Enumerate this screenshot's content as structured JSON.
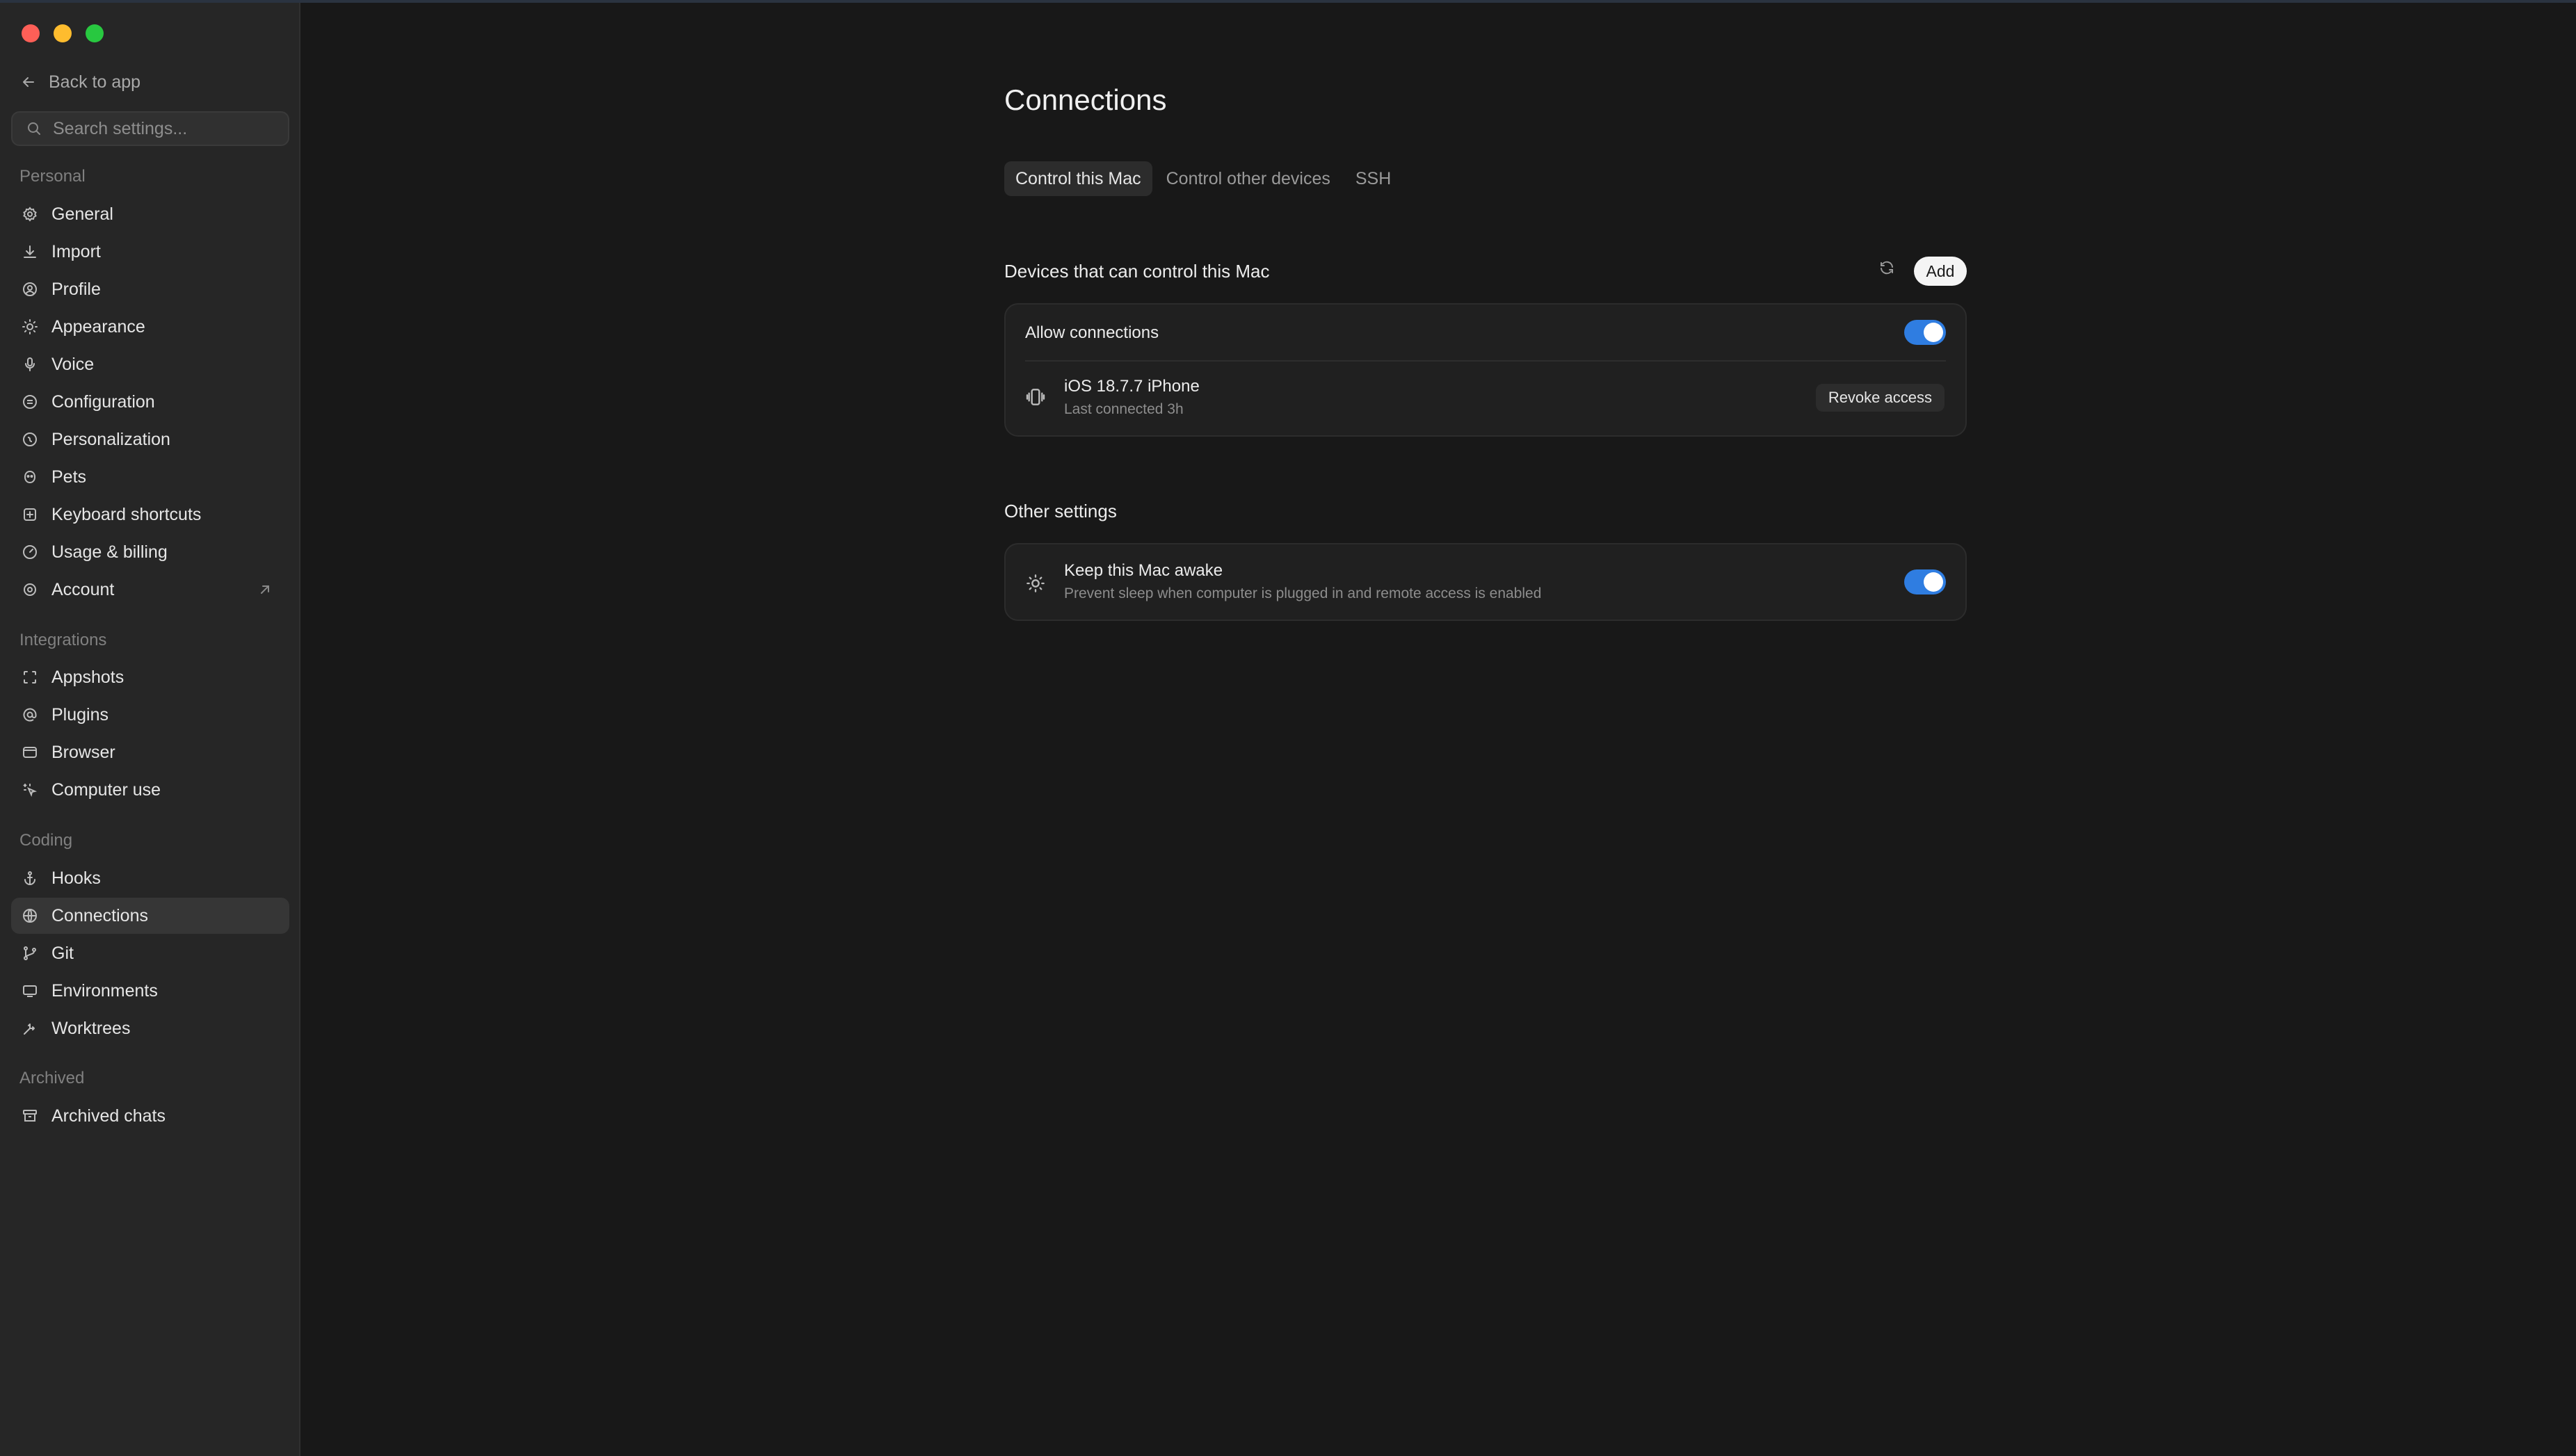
{
  "window": {
    "controls": [
      "close",
      "minimize",
      "maximize"
    ]
  },
  "sidebar": {
    "back_label": "Back to app",
    "search_placeholder": "Search settings...",
    "sections": [
      {
        "label": "Personal"
      },
      {
        "label": "Integrations"
      },
      {
        "label": "Coding"
      },
      {
        "label": "Archived"
      }
    ],
    "items": [
      {
        "label": "General",
        "icon": "gear-icon"
      },
      {
        "label": "Import",
        "icon": "download-icon"
      },
      {
        "label": "Profile",
        "icon": "user-circle-icon"
      },
      {
        "label": "Appearance",
        "icon": "sun-icon"
      },
      {
        "label": "Voice",
        "icon": "microphone-icon"
      },
      {
        "label": "Configuration",
        "icon": "sliders-circle-icon"
      },
      {
        "label": "Personalization",
        "icon": "sparkle-circle-icon"
      },
      {
        "label": "Pets",
        "icon": "pet-icon"
      },
      {
        "label": "Keyboard shortcuts",
        "icon": "keyboard-plus-icon"
      },
      {
        "label": "Usage & billing",
        "icon": "gauge-icon"
      },
      {
        "label": "Account",
        "icon": "account-gear-icon"
      },
      {
        "label": "Appshots",
        "icon": "scan-frame-icon"
      },
      {
        "label": "Plugins",
        "icon": "at-sign-icon"
      },
      {
        "label": "Browser",
        "icon": "browser-window-icon"
      },
      {
        "label": "Computer use",
        "icon": "pointer-sparkle-icon"
      },
      {
        "label": "Hooks",
        "icon": "anchor-icon"
      },
      {
        "label": "Connections",
        "icon": "globe-icon"
      },
      {
        "label": "Git",
        "icon": "git-branch-icon"
      },
      {
        "label": "Environments",
        "icon": "monitor-icon"
      },
      {
        "label": "Worktrees",
        "icon": "worktree-icon"
      },
      {
        "label": "Archived chats",
        "icon": "archive-icon"
      }
    ],
    "active_item": "Connections"
  },
  "main": {
    "title": "Connections",
    "tabs": [
      {
        "label": "Control this Mac",
        "active": true
      },
      {
        "label": "Control other devices",
        "active": false
      },
      {
        "label": "SSH",
        "active": false
      }
    ],
    "devices_section": {
      "heading": "Devices that can control this Mac",
      "add_label": "Add",
      "allow_connections_label": "Allow connections",
      "allow_connections_on": true,
      "device": {
        "name": "iOS 18.7.7 iPhone",
        "last_connected": "Last connected 3h",
        "revoke_label": "Revoke access"
      }
    },
    "other_section": {
      "heading": "Other settings",
      "keep_awake_label": "Keep this Mac awake",
      "keep_awake_desc": "Prevent sleep when computer is plugged in and remote access is enabled",
      "keep_awake_on": true
    }
  },
  "colors": {
    "accent": "#2f7de1",
    "background": "#181818",
    "sidebar": "#262626"
  }
}
